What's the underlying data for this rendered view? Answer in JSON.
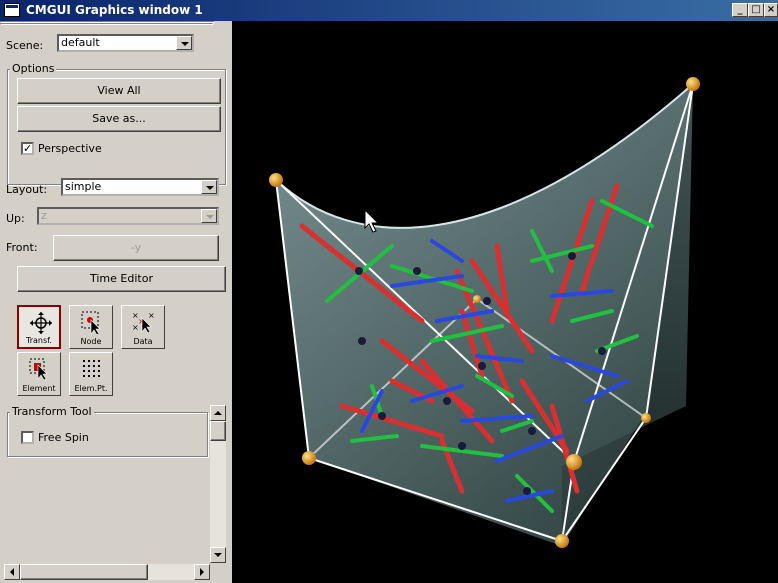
{
  "window": {
    "title": "CMGUI Graphics window 1",
    "minimize": "_",
    "maximize": "□",
    "close": "×"
  },
  "scene": {
    "label": "Scene:",
    "value": "default"
  },
  "options": {
    "title": "Options",
    "view_all": "View All",
    "save_as": "Save as...",
    "perspective_label": "Perspective",
    "perspective_checked": true
  },
  "layout": {
    "label": "Layout:",
    "value": "simple"
  },
  "up": {
    "label": "Up:",
    "value": "z"
  },
  "front": {
    "label": "Front:",
    "value": "-y"
  },
  "time_editor": "Time Editor",
  "tools": [
    {
      "label": "Transf.",
      "icon": "transform-tool-icon",
      "active": true
    },
    {
      "label": "Node",
      "icon": "node-tool-icon",
      "active": false
    },
    {
      "label": "Data",
      "icon": "data-tool-icon",
      "active": false
    },
    {
      "label": "Element",
      "icon": "element-tool-icon",
      "active": false
    },
    {
      "label": "Elem.Pt.",
      "icon": "element-point-tool-icon",
      "active": false
    }
  ],
  "transform_tool": {
    "title": "Transform Tool",
    "free_spin_label": "Free Spin",
    "free_spin_checked": false
  },
  "colors": {
    "title_bar": "#0a246a",
    "panel": "#d4d0c8",
    "viewport": "#000000",
    "node": "#f0a000",
    "axis_x": "#e03030",
    "axis_y": "#20c020",
    "axis_z": "#2040e0"
  }
}
